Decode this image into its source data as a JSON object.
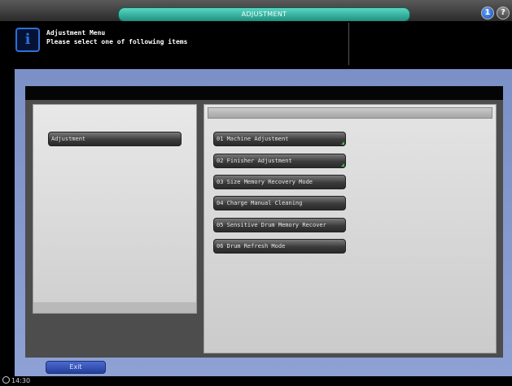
{
  "header": {
    "title": "ADJUSTMENT",
    "help_label": "?",
    "mode_label": "1"
  },
  "message": {
    "icon_label": "i",
    "line1": "Adjustment Menu",
    "line2": "Please select one of following items"
  },
  "left_panel": {
    "selected_category": "Adjustment"
  },
  "menu": {
    "items": [
      {
        "label": "01 Machine Adjustment",
        "has_submenu": true
      },
      {
        "label": "02 Finisher Adjustment",
        "has_submenu": true
      },
      {
        "label": "03 Size Memory Recovery Mode",
        "has_submenu": false
      },
      {
        "label": "04 Charge Manual Cleaning",
        "has_submenu": false
      },
      {
        "label": "05 Sensitive Drum Memory Recover",
        "has_submenu": false
      },
      {
        "label": "06 Drum Refresh Mode",
        "has_submenu": false
      }
    ]
  },
  "footer": {
    "exit_label": "Exit",
    "clock": "14:30"
  },
  "colors": {
    "title_pill": "#3fb8a5",
    "frame": "#8496cc",
    "exit_button": "#3552b8",
    "submenu_mark": "#3ec44a"
  }
}
